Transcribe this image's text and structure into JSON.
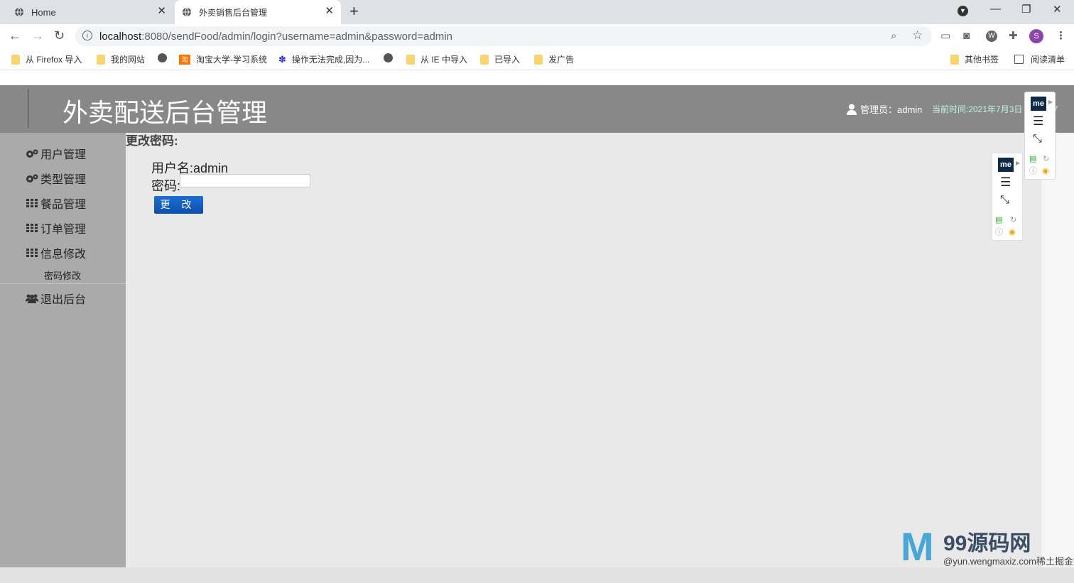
{
  "browser": {
    "tabs": [
      {
        "title": "Home"
      },
      {
        "title": "外卖销售后台管理"
      }
    ],
    "url_host": "localhost",
    "url_rest": ":8080/sendFood/admin/login?username=admin&password=admin",
    "profile_initial": "S",
    "bookmarks": [
      {
        "label": "从 Firefox 导入",
        "icon": "folder"
      },
      {
        "label": "我的网站",
        "icon": "folder"
      },
      {
        "label": "",
        "icon": "globe"
      },
      {
        "label": "淘宝大学-学习系统",
        "icon": "taobao"
      },
      {
        "label": "操作无法完成,因为...",
        "icon": "baidu-paw"
      },
      {
        "label": "",
        "icon": "globe"
      },
      {
        "label": "从 IE 中导入",
        "icon": "folder"
      },
      {
        "label": "已导入",
        "icon": "folder"
      },
      {
        "label": "发广告",
        "icon": "folder"
      }
    ],
    "other_bookmarks": "其他书签",
    "reading_list": "阅读清单"
  },
  "header": {
    "title": "外卖配送后台管理",
    "admin_label": "管理员：admin",
    "clock": "当前时间:2021年7月3日 13:33:37"
  },
  "sidebar": {
    "items": [
      {
        "label": "用户管理",
        "icon": "gears-icon"
      },
      {
        "label": "类型管理",
        "icon": "gears-icon"
      },
      {
        "label": "餐品管理",
        "icon": "grid-icon"
      },
      {
        "label": "订单管理",
        "icon": "grid-icon"
      },
      {
        "label": "信息修改",
        "icon": "grid-icon"
      }
    ],
    "sub_item": "密码修改",
    "logout": {
      "label": "退出后台",
      "icon": "users-icon"
    }
  },
  "form": {
    "section_title": "更改密码:",
    "username_line": "用户名:admin",
    "password_label": "密码:",
    "password_value": "",
    "submit_label": "更改"
  },
  "extension": {
    "badge": "me"
  },
  "watermark": {
    "title": "99源码网",
    "subtitle": "@yun.wengmaxiz.com稀土掘金技术社区"
  },
  "colors": {
    "header_bg": "#888888",
    "sidebar_bg": "#aaaaaa",
    "main_bg": "#e9e9e9",
    "button_blue": "#0b4fae",
    "clock_color": "#bff5e7"
  }
}
